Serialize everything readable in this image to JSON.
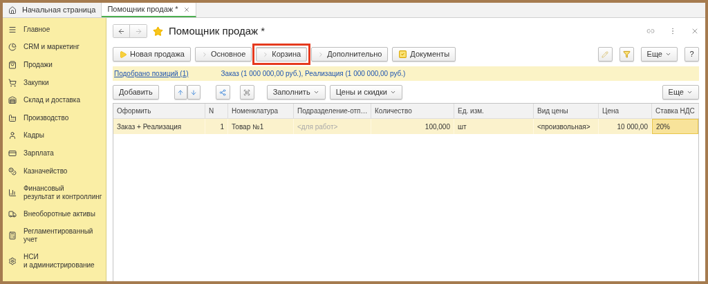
{
  "tabs": [
    {
      "label": "Начальная страница",
      "selected": false,
      "closable": false
    },
    {
      "label": "Помощник продаж *",
      "selected": true,
      "closable": true
    }
  ],
  "sidebar": {
    "items": [
      {
        "label": "Главное"
      },
      {
        "label": "CRM и маркетинг"
      },
      {
        "label": "Продажи"
      },
      {
        "label": "Закупки"
      },
      {
        "label": "Склад и доставка"
      },
      {
        "label": "Производство"
      },
      {
        "label": "Кадры"
      },
      {
        "label": "Зарплата"
      },
      {
        "label": "Казначейство"
      },
      {
        "label": "Финансовый\nрезультат и контроллинг"
      },
      {
        "label": "Внеоборотные активы"
      },
      {
        "label": "Регламентированный\nучет"
      },
      {
        "label": "НСИ\nи администрирование"
      }
    ]
  },
  "form": {
    "title": "Помощник продаж *",
    "steps": [
      {
        "label": "Новая продажа",
        "kind": "start",
        "selected": false,
        "highlighted": false
      },
      {
        "label": "Основное",
        "kind": "step",
        "selected": false,
        "highlighted": false
      },
      {
        "label": "Корзина",
        "kind": "step",
        "selected": true,
        "highlighted": true
      },
      {
        "label": "Дополнительно",
        "kind": "step",
        "selected": false,
        "highlighted": false
      },
      {
        "label": "Документы",
        "kind": "docs",
        "selected": false,
        "highlighted": false
      }
    ],
    "more_button": "Еще",
    "help_button": "?",
    "info": {
      "link": "Подобрано позиций (1)",
      "summary": "Заказ (1 000 000,00 руб.), Реализация (1 000 000,00 руб.)"
    },
    "table_toolbar": {
      "add": "Добавить",
      "fill": "Заполнить",
      "prices": "Цены и скидки",
      "more": "Еще"
    },
    "table": {
      "columns": [
        "Оформить",
        "N",
        "Номенклатура",
        "Подразделение-отп…",
        "Количество",
        "Ед. изм.",
        "Вид цены",
        "Цена",
        "Ставка НДС"
      ],
      "rows": [
        {
          "selected": true,
          "cells": [
            {
              "text": "Заказ + Реализация",
              "dimmed": false,
              "active": false
            },
            {
              "text": "1",
              "dimmed": false,
              "active": false
            },
            {
              "text": "Товар №1",
              "dimmed": false,
              "active": false
            },
            {
              "text": "<для работ>",
              "dimmed": true,
              "active": false
            },
            {
              "text": "100,000",
              "dimmed": false,
              "active": false
            },
            {
              "text": "шт",
              "dimmed": false,
              "active": false
            },
            {
              "text": "<произвольная>",
              "dimmed": false,
              "active": false
            },
            {
              "text": "10 000,00",
              "dimmed": false,
              "active": false
            },
            {
              "text": "20%",
              "dimmed": false,
              "active": true
            }
          ]
        }
      ]
    }
  }
}
